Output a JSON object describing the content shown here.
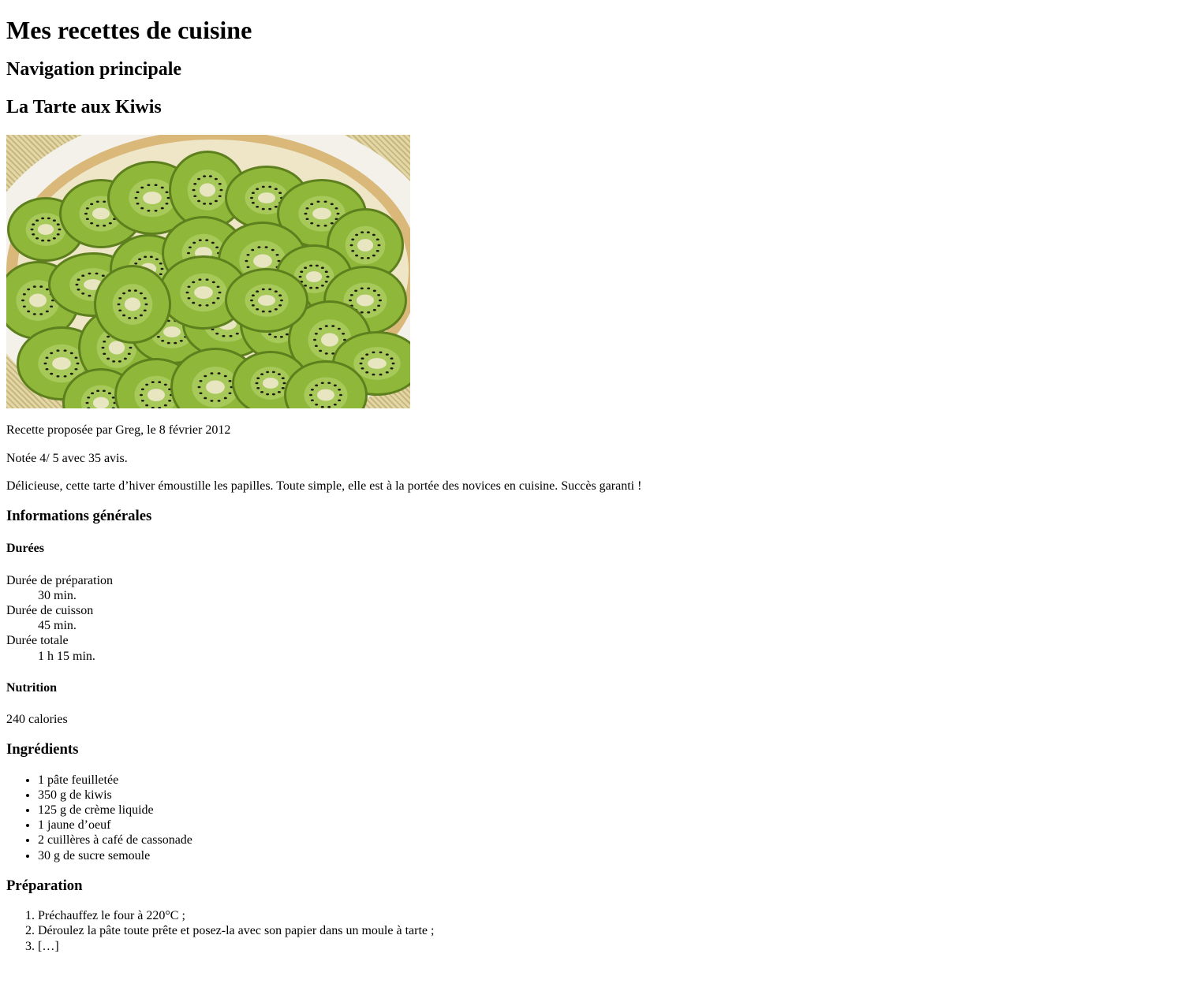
{
  "site": {
    "title": "Mes recettes de cuisine",
    "nav_heading": "Navigation principale"
  },
  "recipe": {
    "title": "La Tarte aux Kiwis",
    "byline": "Recette proposée par Greg, le 8 février 2012",
    "rating": "Notée 4/ 5 avec 35 avis.",
    "description": "Délicieuse, cette tarte d’hiver émoustille les papilles. Toute simple, elle est à la portée des novices en cuisine. Succès garanti !"
  },
  "general": {
    "heading": "Informations générales",
    "durations": {
      "heading": "Durées",
      "items": [
        {
          "label": "Durée de préparation",
          "value": "30 min."
        },
        {
          "label": "Durée de cuisson",
          "value": "45 min."
        },
        {
          "label": "Durée totale",
          "value": "1 h 15 min."
        }
      ]
    },
    "nutrition": {
      "heading": "Nutrition",
      "calories": "240 calories"
    }
  },
  "ingredients": {
    "heading": "Ingrédients",
    "items": [
      "1 pâte feuilletée",
      "350 g de kiwis",
      "125 g de crème liquide",
      "1 jaune d’oeuf",
      "2 cuillères à café de cassonade",
      "30 g de sucre semoule"
    ]
  },
  "preparation": {
    "heading": "Préparation",
    "steps": [
      "Préchauffez le four à 220°C ;",
      "Déroulez la pâte toute prête et posez-la avec son papier dans un moule à tarte ;",
      "[…]"
    ]
  },
  "colors": {
    "kiwi_flesh": "#8fb83a",
    "kiwi_core": "#e8e6c0",
    "crust": "#d9b87a",
    "dish": "#f3f1ea"
  }
}
